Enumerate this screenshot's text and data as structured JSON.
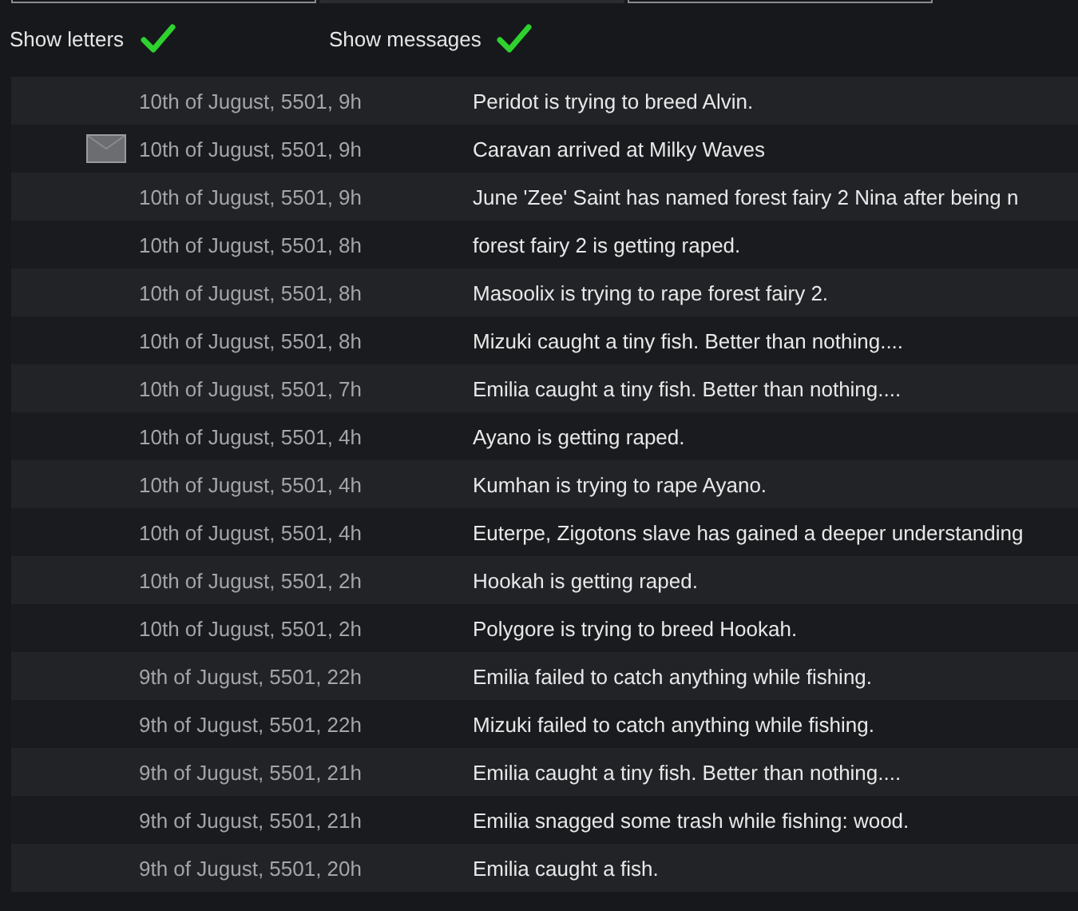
{
  "tabs": [
    {
      "selected": false
    },
    {
      "selected": true
    },
    {
      "selected": false
    }
  ],
  "filters": [
    {
      "label": "Show letters",
      "checked": true
    },
    {
      "label": "Show messages",
      "checked": true
    }
  ],
  "log": [
    {
      "kind": "message",
      "date": "10th of Jugust, 5501, 9h",
      "text": "Peridot is trying to breed Alvin."
    },
    {
      "kind": "letter",
      "date": "10th of Jugust, 5501, 9h",
      "text": "Caravan arrived at Milky Waves"
    },
    {
      "kind": "message",
      "date": "10th of Jugust, 5501, 9h",
      "text": "June 'Zee' Saint has named forest fairy 2 Nina after being n"
    },
    {
      "kind": "message",
      "date": "10th of Jugust, 5501, 8h",
      "text": "forest fairy 2 is getting raped."
    },
    {
      "kind": "message",
      "date": "10th of Jugust, 5501, 8h",
      "text": "Masoolix is trying to rape forest fairy 2."
    },
    {
      "kind": "message",
      "date": "10th of Jugust, 5501, 8h",
      "text": "Mizuki caught a tiny fish. Better than nothing...."
    },
    {
      "kind": "message",
      "date": "10th of Jugust, 5501, 7h",
      "text": "Emilia caught a tiny fish. Better than nothing...."
    },
    {
      "kind": "message",
      "date": "10th of Jugust, 5501, 4h",
      "text": "Ayano is getting raped."
    },
    {
      "kind": "message",
      "date": "10th of Jugust, 5501, 4h",
      "text": "Kumhan is trying to rape Ayano."
    },
    {
      "kind": "message",
      "date": "10th of Jugust, 5501, 4h",
      "text": "Euterpe, Zigotons slave has gained a deeper understanding"
    },
    {
      "kind": "message",
      "date": "10th of Jugust, 5501, 2h",
      "text": "Hookah is getting raped."
    },
    {
      "kind": "message",
      "date": "10th of Jugust, 5501, 2h",
      "text": "Polygore is trying to breed Hookah."
    },
    {
      "kind": "message",
      "date": "9th of Jugust, 5501, 22h",
      "text": "Emilia failed to catch anything while fishing."
    },
    {
      "kind": "message",
      "date": "9th of Jugust, 5501, 22h",
      "text": "Mizuki failed to catch anything while fishing."
    },
    {
      "kind": "message",
      "date": "9th of Jugust, 5501, 21h",
      "text": "Emilia caught a tiny fish. Better than nothing...."
    },
    {
      "kind": "message",
      "date": "9th of Jugust, 5501, 21h",
      "text": "Emilia snagged some trash while fishing: wood."
    },
    {
      "kind": "message",
      "date": "9th of Jugust, 5501, 20h",
      "text": "Emilia caught a fish."
    }
  ]
}
